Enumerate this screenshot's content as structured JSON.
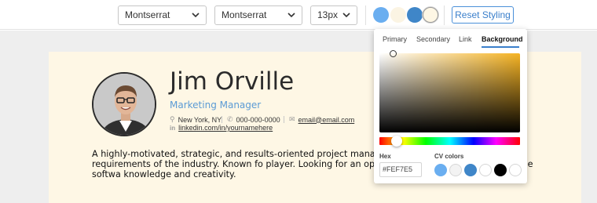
{
  "toolbar": {
    "heading_font": "Montserrat",
    "body_font": "Montserrat",
    "font_size": "13px",
    "theme_swatches": [
      {
        "name": "primary",
        "color": "#6aaef0"
      },
      {
        "name": "secondary",
        "color": "#fbf4e3"
      },
      {
        "name": "link",
        "color": "#3f86c8"
      },
      {
        "name": "background",
        "color": "#fef7e5",
        "selected": true
      }
    ],
    "reset_label": "Reset Styling"
  },
  "picker": {
    "tabs": [
      {
        "label": "Primary",
        "active": false
      },
      {
        "label": "Secondary",
        "active": false
      },
      {
        "label": "Link",
        "active": false
      },
      {
        "label": "Background",
        "active": true
      }
    ],
    "hex_label": "Hex",
    "hex_value": "#FEF7E5",
    "cv_colors_label": "CV colors",
    "cv_colors": [
      "#6aaef0",
      "#f3f3f3",
      "#3f86c8",
      "#ffffff",
      "#000000",
      "#ffffff"
    ],
    "current_hue": "#f5b323"
  },
  "resume": {
    "background": "#fef7e5",
    "name": "Jim Orville",
    "title": "Marketing Manager",
    "location": "New York, NY",
    "phone": "000-000-0000",
    "email": "email@email.com",
    "linkedin": "linkedin.com/in/yournamehere",
    "summary": "A highly-motivated, strategic, and results-oriented project manage set to meet the ever-changing requirements of the industry. Known fo player. Looking for an opportunity to assist companies in the softwa knowledge and creativity."
  }
}
